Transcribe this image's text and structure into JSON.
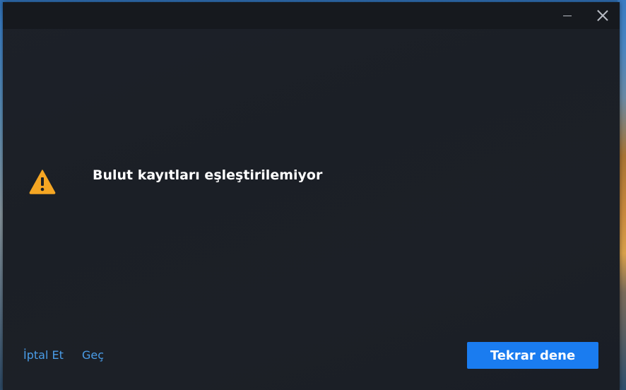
{
  "dialog": {
    "title": "Bulut kayıtları eşleştirilemiyor",
    "icon": "warning-icon",
    "icon_color": "#f5a623",
    "cancel_label": "İptal Et",
    "skip_label": "Geç",
    "retry_label": "Tekrar dene",
    "accent_color": "#1a7cf0",
    "link_color": "#4a9de8"
  },
  "titlebar": {
    "minimize_icon": "minimize-icon",
    "close_icon": "close-icon"
  }
}
